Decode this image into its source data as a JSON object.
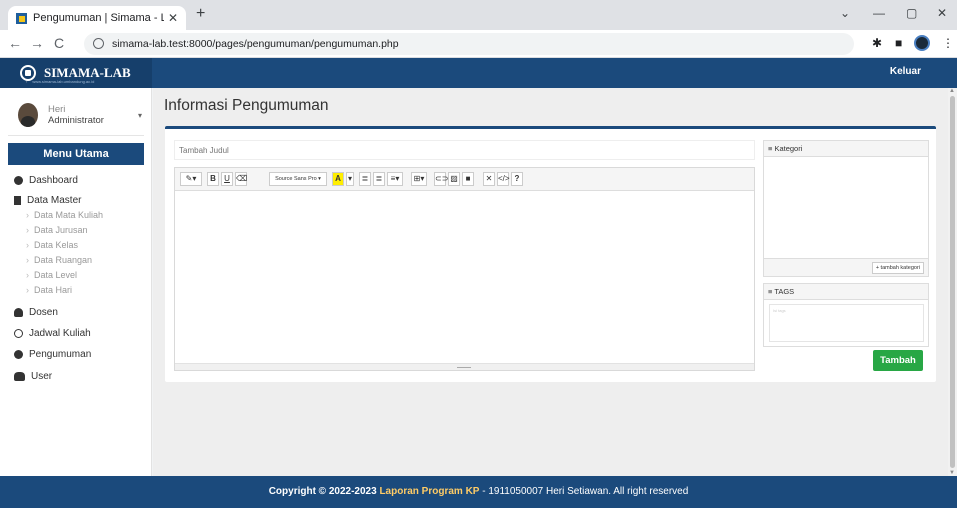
{
  "browser": {
    "tab_title": "Pengumuman | Simama - Lab",
    "url": "simama-lab.test:8000/pages/pengumuman/pengumuman.php"
  },
  "header": {
    "brand_name": "SIMAMA-LAB",
    "brand_sub": "www.simama-lab.umbandung.ac.id",
    "logout": "Keluar"
  },
  "user": {
    "name": "Heri",
    "role": "Administrator"
  },
  "sidebar": {
    "menu_title": "Menu Utama",
    "items": [
      {
        "label": "Dashboard",
        "icon": "dashboard-icon"
      },
      {
        "label": "Data Master",
        "icon": "bookmark-icon"
      },
      {
        "label": "Dosen",
        "icon": "user-plus-icon"
      },
      {
        "label": "Jadwal Kuliah",
        "icon": "search-icon"
      },
      {
        "label": "Pengumuman",
        "icon": "info-icon"
      },
      {
        "label": "User",
        "icon": "users-icon"
      }
    ],
    "submenu": [
      "Data Mata Kuliah",
      "Data Jurusan",
      "Data Kelas",
      "Data Ruangan",
      "Data Level",
      "Data Hari"
    ]
  },
  "main": {
    "page_title": "Informasi Pengumuman",
    "title_placeholder": "Tambah Judul",
    "font_select": "Source Sans Pro",
    "kategori_label": "≡ Kategori",
    "tambah_kategori": "+ tambah kategori",
    "tags_label": "≡ TAGS",
    "tags_placeholder": "Isi tags",
    "submit_label": "Tambah"
  },
  "footer": {
    "prefix": "Copyright © 2022-2023 ",
    "project": "Laporan Program KP",
    "suffix": " - 1911050007 Heri Setiawan. All right reserved"
  }
}
